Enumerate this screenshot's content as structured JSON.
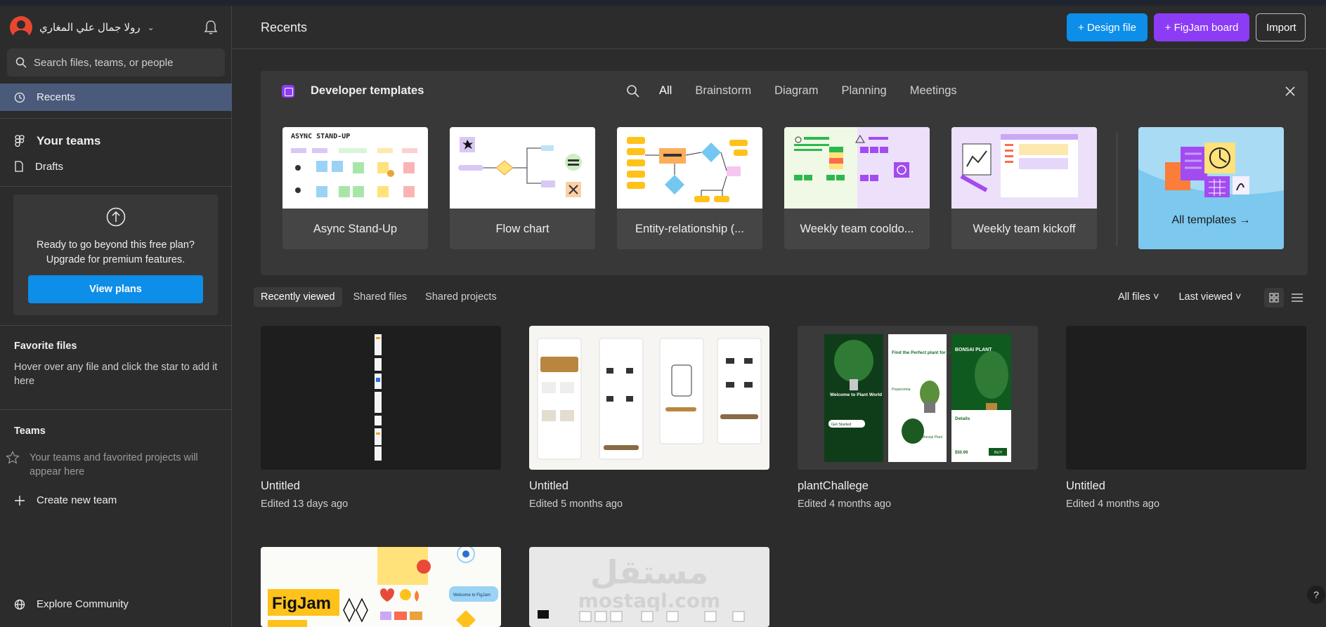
{
  "sidebar": {
    "username": "رولا جمال علي المغاري",
    "search_placeholder": "Search files, teams, or people",
    "nav": {
      "recents": "Recents",
      "your_teams": "Your teams",
      "drafts": "Drafts"
    },
    "upgrade": {
      "line1": "Ready to go beyond this free plan?",
      "line2": "Upgrade for premium features.",
      "button": "View plans"
    },
    "favorites": {
      "title": "Favorite files",
      "text": "Hover over any file and click the star to add it here"
    },
    "teams": {
      "title": "Teams",
      "text": "Your teams and favorited projects will appear here",
      "create": "Create new team"
    },
    "explore": "Explore Community"
  },
  "header": {
    "title": "Recents",
    "design_file": "+ Design file",
    "figjam_board": "+ FigJam board",
    "import": "Import"
  },
  "templates": {
    "title": "Developer templates",
    "tabs": [
      "All",
      "Brainstorm",
      "Diagram",
      "Planning",
      "Meetings"
    ],
    "cards": [
      "Async Stand-Up",
      "Flow chart",
      "Entity-relationship (...",
      "Weekly team cooldo...",
      "Weekly team kickoff"
    ],
    "all_templates": "All templates →",
    "async_heading": "ASYNC STAND-UP"
  },
  "file_tabs": [
    "Recently viewed",
    "Shared files",
    "Shared projects"
  ],
  "filters": {
    "files": "All files",
    "sort": "Last viewed"
  },
  "files": [
    {
      "name": "Untitled",
      "meta": "Edited 13 days ago"
    },
    {
      "name": "Untitled",
      "meta": "Edited 5 months ago"
    },
    {
      "name": "plantChallege",
      "meta": "Edited 4 months ago"
    },
    {
      "name": "Untitled",
      "meta": "Edited 4 months ago"
    }
  ],
  "plant_texts": {
    "welcome": "Welcome to Plant World",
    "get_started": "Get Started",
    "find": "Find the Perfect plant for your home",
    "peperomia": "Peperomia",
    "bonsai_plant": "Bonsai Plant",
    "bonsai": "BONSAI PLANT",
    "details": "Details",
    "price": "$50.99",
    "buy": "BUY"
  },
  "bottom_cards": {
    "figjam_logo": "FigJam",
    "welcome_bubble": "Welcome to FigJam"
  },
  "watermark": {
    "arabic": "مستقل",
    "latin": "mostaql.com"
  },
  "help": "?",
  "colors": {
    "accent_blue": "#0d8ee9",
    "accent_purple": "#8c3cf5",
    "selected_nav": "#4a5a7a"
  }
}
